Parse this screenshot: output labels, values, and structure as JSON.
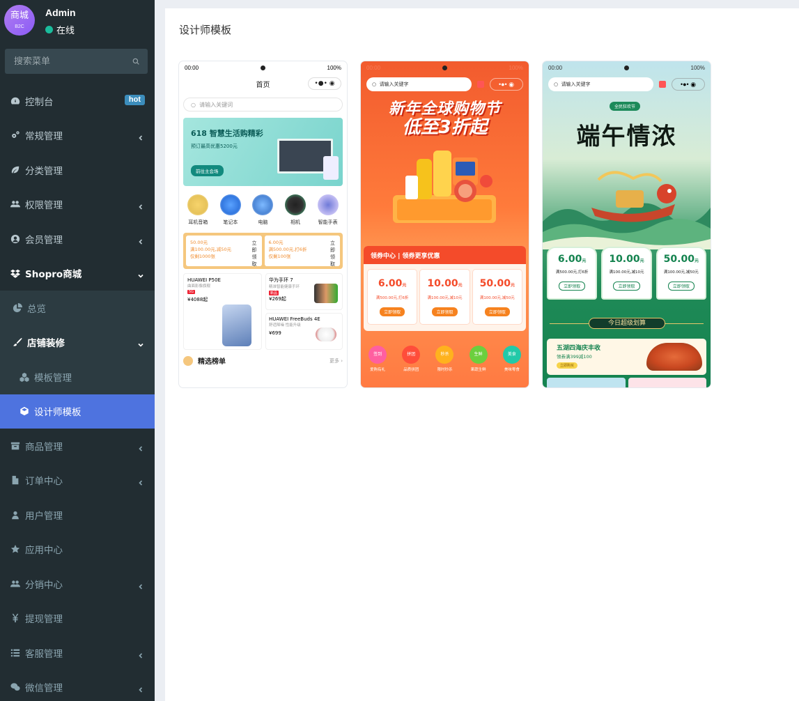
{
  "user": {
    "avatar_text": "商城",
    "avatar_sub": "B2C",
    "name": "Admin",
    "status": "在线"
  },
  "search": {
    "placeholder": "搜索菜单"
  },
  "menu": {
    "dashboard": "控制台",
    "dashboard_badge": "hot",
    "general": "常规管理",
    "category": "分类管理",
    "auth": "权限管理",
    "member": "会员管理",
    "shopro": "Shopro商城",
    "overview": "总览",
    "decorate": "店铺装修",
    "template_mgr": "模板管理",
    "designer_template": "设计师模板",
    "goods": "商品管理",
    "orders": "订单中心",
    "users": "用户管理",
    "apps": "应用中心",
    "distribution": "分销中心",
    "withdraw": "提现管理",
    "service": "客服管理",
    "wechat": "微信管理"
  },
  "page": {
    "title": "设计师模板"
  },
  "templates": {
    "t1": {
      "time": "00:00",
      "battery": "100%",
      "nav_title": "首页",
      "search": "请输入关键词",
      "banner_title": "618 智慧生活购精彩",
      "banner_sub": "预订最高优惠5200元",
      "banner_btn": "前往主会场",
      "cats": [
        "耳机音箱",
        "笔记本",
        "电脑",
        "相机",
        "智能手表"
      ],
      "coupon1": [
        "50.00元",
        "满100.00元,减50元",
        "仅剩1000张"
      ],
      "coupon2": [
        "6.00元",
        "满500.00元,打6折",
        "仅剩100张"
      ],
      "coupon_get": "立即领取",
      "prod1_name": "HUAWEI P50E",
      "prod1_sub": "曲面影像旗舰",
      "prod1_price": "¥4088起",
      "prod2_name": "华为手环 7",
      "prod2_sub": "精准智能健康手环",
      "prod2_price": "¥269起",
      "prod3_name": "HUAWEI FreeBuds 4E",
      "prod3_sub": "舒适降噪 性能升级",
      "prod3_price": "¥699",
      "rank_title": "精选榜单",
      "rank_more": "更多 ›"
    },
    "t2": {
      "time": "00:00",
      "search": "请输入关键字",
      "hero1": "新年全球购物节",
      "hero2": "低至3折起",
      "coupon_head": "领券中心 | 领券更享优惠",
      "coupons": [
        {
          "amt": "6.00",
          "cond": "满500.00元,打6折"
        },
        {
          "amt": "10.00",
          "cond": "满100.00元,减10元"
        },
        {
          "amt": "50.00",
          "cond": "满100.00元,减50元"
        }
      ],
      "unit": "元",
      "get": "立即领取",
      "quick": [
        "爱购有礼",
        "品质拼团",
        "限时秒杀",
        "果蔬生鲜",
        "美味零食"
      ],
      "quick_short": [
        "签到",
        "拼团",
        "秒杀",
        "生鲜",
        "美食"
      ]
    },
    "t3": {
      "time": "00:00",
      "search": "请输入关键字",
      "pre": "全民狂欢节",
      "title": "端午情浓",
      "coupons": [
        {
          "amt": "6.00",
          "cond": "满500.00元,打6折"
        },
        {
          "amt": "10.00",
          "cond": "满100.00元,减10元"
        },
        {
          "amt": "50.00",
          "cond": "满100.00元,减50元"
        }
      ],
      "unit": "元",
      "get": "立即领取",
      "today": "今日超级划算",
      "promo_title": "五湖四海庆丰收",
      "promo_sub": "领券满399减100",
      "promo_btn": "立即购买"
    }
  }
}
